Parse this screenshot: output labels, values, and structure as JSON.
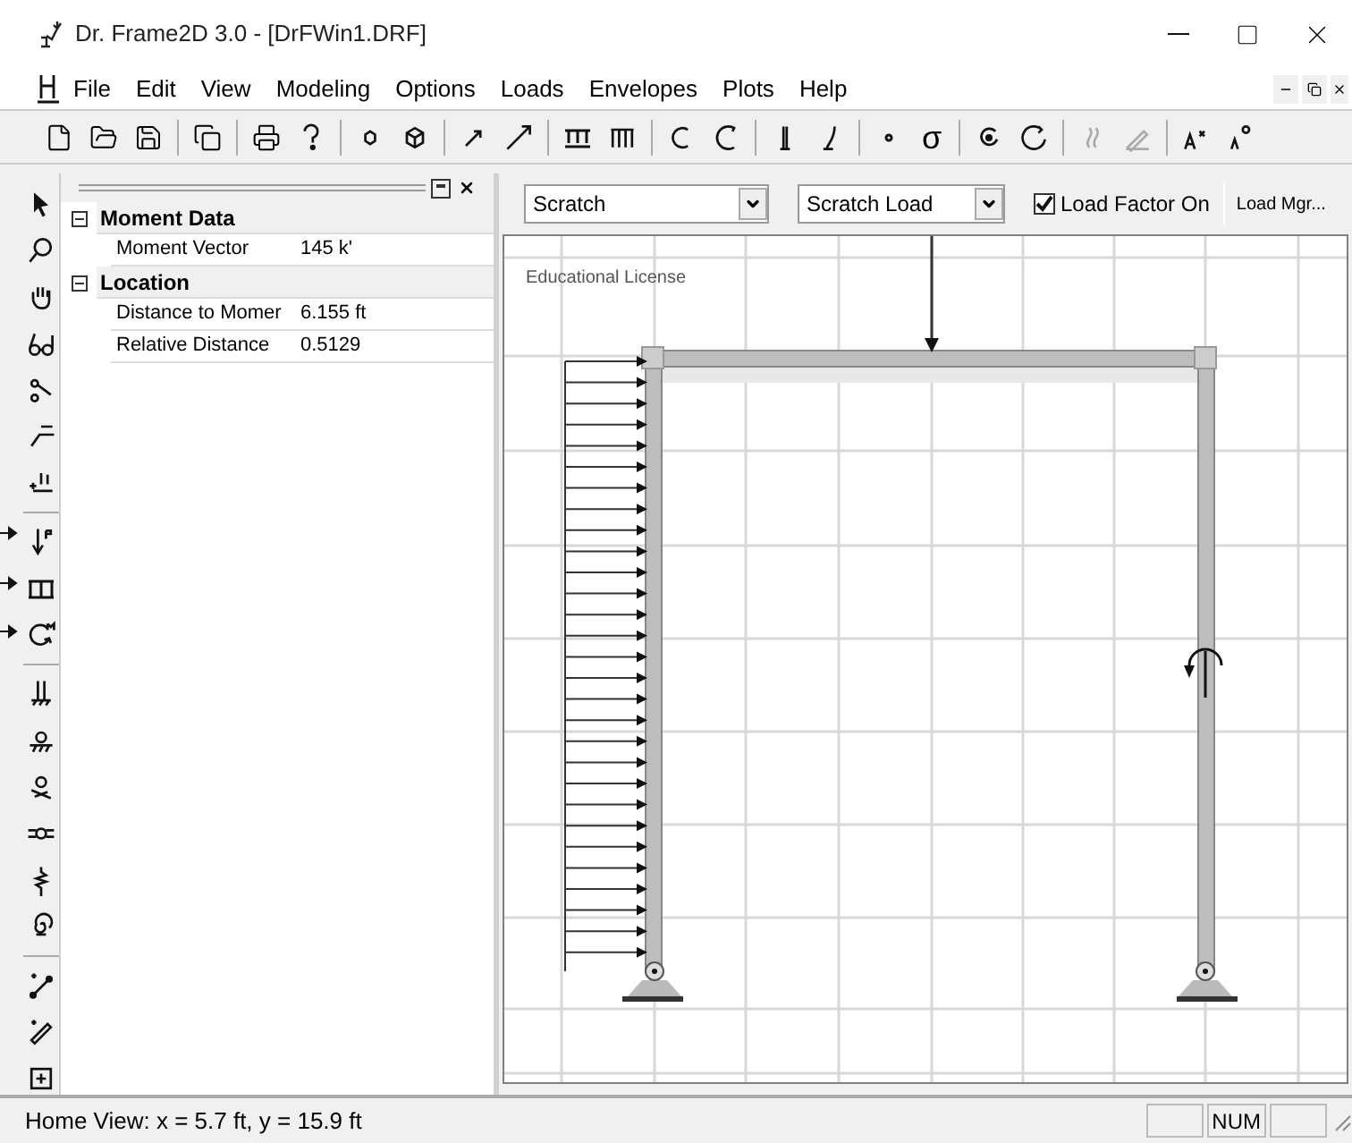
{
  "window": {
    "title": "Dr. Frame2D 3.0 - [DrFWin1.DRF]"
  },
  "menu": [
    "File",
    "Edit",
    "View",
    "Modeling",
    "Options",
    "Loads",
    "Envelopes",
    "Plots",
    "Help"
  ],
  "toolbar": {
    "stress_label": "σ"
  },
  "properties": [
    {
      "title": "Moment Data",
      "expanded": true,
      "rows": [
        {
          "name": "Moment Vector",
          "value": "145 k'"
        }
      ]
    },
    {
      "title": "Location",
      "expanded": true,
      "rows": [
        {
          "name": "Distance to Momer",
          "value": "6.155 ft"
        },
        {
          "name": "Relative Distance",
          "value": "0.5129"
        }
      ]
    }
  ],
  "canvas_bar": {
    "structure_select": "Scratch",
    "load_select": "Scratch Load",
    "load_factor": {
      "label": "Load Factor On",
      "checked": true
    },
    "load_manager_button": "Load Mgr..."
  },
  "canvas": {
    "license_text": "Educational License"
  },
  "status_bar": {
    "message": "Home View: x = 5.7 ft, y = 15.9 ft",
    "indicator": "NUM"
  }
}
